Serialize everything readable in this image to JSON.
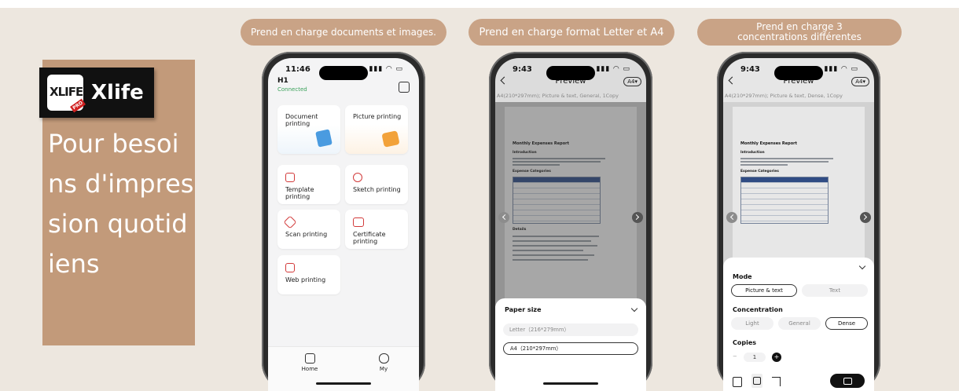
{
  "brand": {
    "logo_text": "XLIFE",
    "logo_badge": "PRO",
    "name": "Xlife",
    "headline": "Pour besoins d'impression quotidiens"
  },
  "features": [
    "Prend en charge documents et images.",
    "Prend en charge format Letter et A4",
    "Prend en charge 3 concentrations différentes"
  ],
  "phone1": {
    "time": "11:46",
    "signal": "▮▮▮ ◠ ▭",
    "device": "H1",
    "connection": "Connected",
    "cards": {
      "doc": "Document printing",
      "picture": "Picture printing",
      "template": "Template printing",
      "sketch": "Sketch printing",
      "scan": "Scan printing",
      "certificate": "Certificate printing",
      "web": "Web printing"
    },
    "tabs": {
      "home": "Home",
      "my": "My"
    }
  },
  "phone2": {
    "time": "9:43",
    "signal": "▮▮▮ ◠ ▭",
    "title": "Preview",
    "size_chip": "A4▾",
    "subinfo": "A4(210*297mm); Picture & text,  General,  1Copy",
    "doc": {
      "title": "Monthly Expenses Report",
      "h1": "Introduction",
      "h2": "Expense Categories",
      "h3": "Details"
    },
    "sheet": {
      "title": "Paper size",
      "options": [
        "Letter（216*279mm）",
        "A4（210*297mm）"
      ],
      "selected": 1
    }
  },
  "phone3": {
    "time": "9:43",
    "signal": "▮▮▮ ◠ ▭",
    "title": "Preview",
    "size_chip": "A4▾",
    "subinfo": "A4(210*297mm); Picture & text,  Dense,  1Copy",
    "doc": {
      "title": "Monthly Expenses Report",
      "h1": "Introduction",
      "h2": "Expense Categories"
    },
    "sheet": {
      "mode_title": "Mode",
      "modes": [
        "Picture & text",
        "Text"
      ],
      "concentration_title": "Concentration",
      "concentrations": [
        "Light",
        "General",
        "Dense"
      ],
      "copies_title": "Copies",
      "copies": "1",
      "minus": "−",
      "plus": "+"
    }
  }
}
